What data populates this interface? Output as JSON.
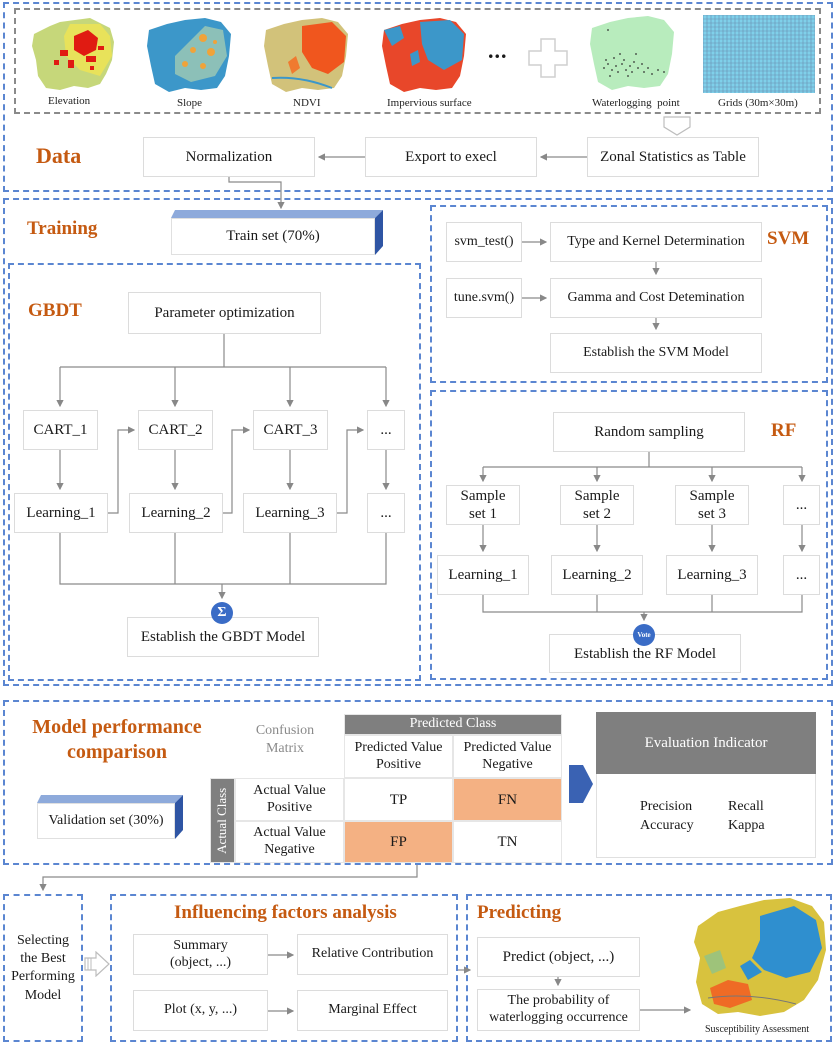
{
  "data_section": {
    "title": "Data",
    "maps": [
      {
        "label": "Elevation",
        "icon": "elevation-map"
      },
      {
        "label": "Slope",
        "icon": "slope-map"
      },
      {
        "label": "NDVI",
        "icon": "ndvi-map"
      },
      {
        "label": "Impervious surface",
        "icon": "impervious-surface-map"
      }
    ],
    "ellipsis": "...",
    "plus_icon": "plus-icon",
    "waterlogging_label": "Waterlogging  point",
    "grids_label": "Grids (30m×30m)",
    "steps": {
      "zonal": "Zonal Statistics as Table",
      "export": "Export to execl",
      "normalization": "Normalization"
    }
  },
  "training": {
    "title": "Training",
    "train_set": "Train set (70%)"
  },
  "gbdt": {
    "title": "GBDT",
    "param_opt": "Parameter optimization",
    "carts": [
      "CART_1",
      "CART_2",
      "CART_3",
      "..."
    ],
    "learnings": [
      "Learning_1",
      "Learning_2",
      "Learning_3",
      "..."
    ],
    "sum_symbol": "Σ",
    "establish": "Establish the GBDT Model"
  },
  "svm": {
    "title": "SVM",
    "svm_test": "svm_test()",
    "tune_svm": "tune.svm()",
    "type_kernel": "Type and Kernel Determination",
    "gamma_cost": "Gamma and Cost Detemination",
    "establish": "Establish the SVM Model"
  },
  "rf": {
    "title": "RF",
    "random_sampling": "Random sampling",
    "samples": [
      "Sample\nset 1",
      "Sample\nset 2",
      "Sample\nset 3",
      "..."
    ],
    "learnings": [
      "Learning_1",
      "Learning_2",
      "Learning_3",
      "..."
    ],
    "vote": "Vote",
    "establish": "Establish the RF Model"
  },
  "performance": {
    "title_line1": "Model performance",
    "title_line2": "comparison",
    "validation_set": "Validation set (30%)",
    "confusion_label_1": "Confusion",
    "confusion_label_2": "Matrix",
    "predicted_class": "Predicted Class",
    "actual_class": "Actual Class",
    "pred_pos": "Predicted Value Positive",
    "pred_neg": "Predicted Value Negative",
    "act_pos": "Actual Value Positive",
    "act_neg": "Actual Value Negative",
    "tp": "TP",
    "fn": "FN",
    "fp": "FP",
    "tn": "TN",
    "eval_header": "Evaluation Indicator",
    "metrics": [
      "Precision",
      "Recall",
      "Accuracy",
      "Kappa"
    ]
  },
  "selecting": {
    "label": "Selecting the Best Performing Model"
  },
  "influencing": {
    "title": "Influencing factors analysis",
    "summary": "Summary\n(object, ...)",
    "relative": "Relative Contribution",
    "plot": "Plot (x, y, ...)",
    "marginal": "Marginal Effect"
  },
  "predicting": {
    "title": "Predicting",
    "predict": "Predict (object, ...)",
    "probability": "The probability of\nwaterlogging occurrence",
    "map_caption": "Susceptibility Assessment"
  },
  "colors": {
    "accent_orange": "#c55a11",
    "dash_blue": "#5b86d1",
    "highlight": "#f4b183",
    "header_gray": "#7f7f7f",
    "badge_blue": "#3a6cc6"
  }
}
